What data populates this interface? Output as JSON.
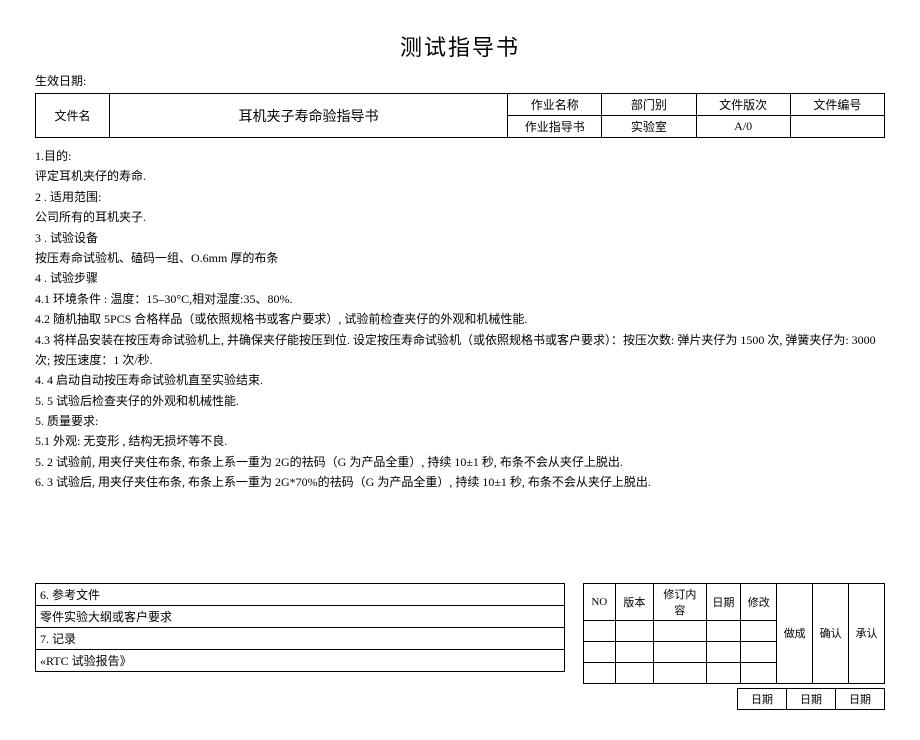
{
  "title": "测试指导书",
  "effective_date_label": "生效日期:",
  "header": {
    "filename_label": "文件名",
    "filename_value": "耳机夹子寿命验指导书",
    "job_name_label": "作业名称",
    "dept_label": "部门别",
    "version_label": "文件版次",
    "docno_label": "文件编号",
    "job_form_label": "作业指导书",
    "dept_value": "实验室",
    "version_value": "A/0",
    "docno_value": ""
  },
  "body": {
    "s1_heading": "1.目的:",
    "s1_text": "评定耳机夹仔的寿命.",
    "s2_heading": "2 . 适用范围:",
    "s2_text": "公司所有的耳机夹子.",
    "s3_heading": "3 . 试验设备",
    "s3_text": "按压寿命试验机、磕码一组、O.6mm 厚的布条",
    "s4_heading": "4 . 试验步骤",
    "s4_1": "4.1 环境条件 : 温度：15–30°C,相对湿度:35、80%.",
    "s4_2": "4.2 随机抽取 5PCS 合格样品（或依照规格书或客户要求）,  试验前检查夹仔的外观和机械性能.",
    "s4_3": "4.3 将样品安装在按压寿命试验机上, 并确保夹仔能按压到位. 设定按压寿命试验机（或依照规格书或客户要求）：按压次数: 弹片夹仔为 1500 次, 弹簧夹仔为: 3000 次; 按压速度：1 次/秒.",
    "s4_4": "4. 4 启动自动按压寿命试验机直至实验结束.",
    "s4_5": "5. 5 试验后检查夹仔的外观和机械性能.",
    "s5_heading": "5. 质量要求:",
    "s5_1": "5.1    外观: 无变形 , 结构无损坏等不良.",
    "s5_2": "5. 2 试验前, 用夹仔夹住布条, 布条上系一重为 2G的祛码（G 为产品全重）, 持续 10±1 秒, 布条不会从夹仔上脱出.",
    "s5_3": "6. 3 试验后, 用夹仔夹住布条, 布条上系一重为 2G*70%的祛码（G 为产品全重）, 持续 10±1 秒, 布条不会从夹仔上脱出."
  },
  "ref": {
    "r1": "6. 参考文件",
    "r2": "零件实验大纲或客户要求",
    "r3": "7. 记录",
    "r4": "«RTC 试验报告》"
  },
  "rev": {
    "no": "NO",
    "version": "版本",
    "content": "修订内容",
    "date": "日期",
    "modify": "修改",
    "make": "做成",
    "confirm": "确认",
    "approve": "承认"
  },
  "sig_date": "日期"
}
